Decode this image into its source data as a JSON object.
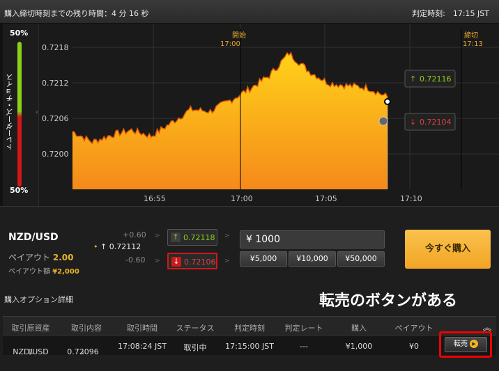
{
  "header": {
    "remaining_label": "購入締切時刻までの残り時間：4 分 16 秒",
    "judge_label": "判定時刻:　17:15 JST"
  },
  "sidebar": {
    "top_pct": "50%",
    "bottom_pct": "50%",
    "vertical_label": "トレーダーズ・チョイス"
  },
  "chart": {
    "start_marker": "開始",
    "start_time": "17:00",
    "close_marker": "締切",
    "close_time": "17:13",
    "y_ticks": [
      "0.7218",
      "0.7212",
      "0.7206",
      "0.7200"
    ],
    "x_ticks": [
      "16:55",
      "17:00",
      "17:05",
      "17:10"
    ],
    "high_price": "0.72116",
    "low_price": "0.72104",
    "colors": {
      "area": "#f6a21a",
      "up": "#8ecf1c",
      "down": "#e04040"
    }
  },
  "chart_data": {
    "type": "area",
    "x": [
      "16:52",
      "16:53",
      "16:54",
      "16:55",
      "16:56",
      "16:57",
      "16:58",
      "16:59",
      "17:00",
      "17:01",
      "17:02",
      "17:03",
      "17:04",
      "17:05",
      "17:06",
      "17:07",
      "17:08"
    ],
    "values": [
      0.72038,
      0.7202,
      0.72032,
      0.7204,
      0.7203,
      0.72052,
      0.72075,
      0.72072,
      0.7209,
      0.7211,
      0.72132,
      0.7217,
      0.7214,
      0.7212,
      0.72115,
      0.72112,
      0.72096
    ],
    "ylim": [
      0.7194,
      0.7222
    ],
    "xlabel": "",
    "ylabel": "",
    "title": ""
  },
  "trade": {
    "pair": "NZD/USD",
    "payout_label": "ペイアウト",
    "payout_value": "2.00",
    "payout_amount_label": "ペイアウト額",
    "payout_amount_value": "¥2,000",
    "strike_up": "+0.60",
    "strike_mid": "0.72112",
    "strike_down": "-0.60",
    "high_btn": "0.72118",
    "low_btn": "0.72106",
    "amount": "¥ 1000",
    "quick": [
      "¥5,000",
      "¥10,000",
      "¥50,000"
    ],
    "buy_now": "今すぐ購入"
  },
  "options": {
    "title": "購入オプション詳細",
    "annotation": "転売のボタンがある",
    "columns": [
      "取引原資産",
      "取引内容",
      "取引時間",
      "ステータス",
      "判定時刻",
      "判定レート",
      "購入",
      "ペイアウト"
    ],
    "row": {
      "asset": "NZD/USD",
      "content": "0.72096",
      "time": "17:08:24 JST",
      "status": "取引中",
      "judge_time": "17:15:00 JST",
      "judge_rate": "---",
      "purchase": "¥1,000",
      "payout": "¥0"
    },
    "resell": "転売"
  }
}
